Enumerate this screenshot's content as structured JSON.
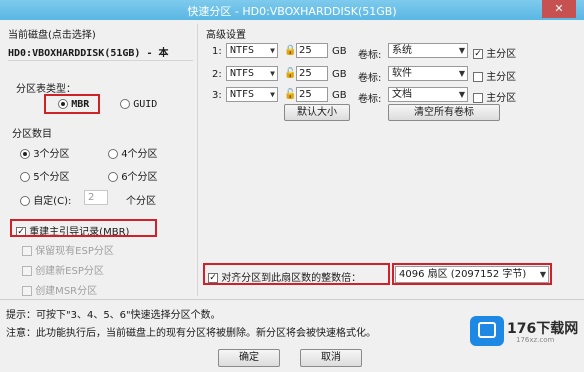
{
  "window": {
    "title": "快速分区 - HD0:VBOXHARDDISK(51GB)",
    "close_label": "✕"
  },
  "left": {
    "current_disk_label": "当前磁盘(点击选择)",
    "disk_value": "HD0:VBOXHARDDISK(51GB) - 本",
    "partition_table_type_label": "分区表类型：",
    "mbr_label": "MBR",
    "guid_label": "GUID",
    "partition_count_label": "分区数目",
    "counts": [
      "3个分区",
      "4个分区",
      "5个分区",
      "6个分区"
    ],
    "custom_label": "自定(C):",
    "custom_value": "2",
    "custom_suffix": "个分区",
    "rebuild_mbr_label": "重建主引导记录(MBR)",
    "keep_esp_label": "保留现有ESP分区",
    "create_esp_label": "创建新ESP分区",
    "create_msr_label": "创建MSR分区"
  },
  "right": {
    "advanced_label": "高级设置",
    "rows": [
      {
        "num": "1:",
        "fs": "NTFS",
        "size": "25",
        "unit": "GB",
        "vol_label": "卷标:",
        "vol": "系统",
        "primary": "主分区",
        "primary_checked": true
      },
      {
        "num": "2:",
        "fs": "NTFS",
        "size": "25",
        "unit": "GB",
        "vol_label": "卷标:",
        "vol": "软件",
        "primary": "主分区",
        "primary_checked": false
      },
      {
        "num": "3:",
        "fs": "NTFS",
        "size": "25",
        "unit": "GB",
        "vol_label": "卷标:",
        "vol": "文档",
        "primary": "主分区",
        "primary_checked": false
      }
    ],
    "default_size_btn": "默认大小",
    "clear_labels_btn": "清空所有卷标",
    "align_label": "对齐分区到此扇区数的整数倍：",
    "align_value": "4096 扇区 (2097152 字节)"
  },
  "bottom": {
    "tip": "提示：可按下\"3、4、5、6\"快速选择分区个数。",
    "note": "注意：此功能执行后，当前磁盘上的现有分区将被删除。新分区将会被快速格式化。",
    "ok": "确定",
    "cancel": "取消"
  },
  "watermark": {
    "brand": "176下载网",
    "url": "176xz.com"
  },
  "colors": {
    "highlight": "#d0202a",
    "titlebar": "#5ab7e3"
  }
}
